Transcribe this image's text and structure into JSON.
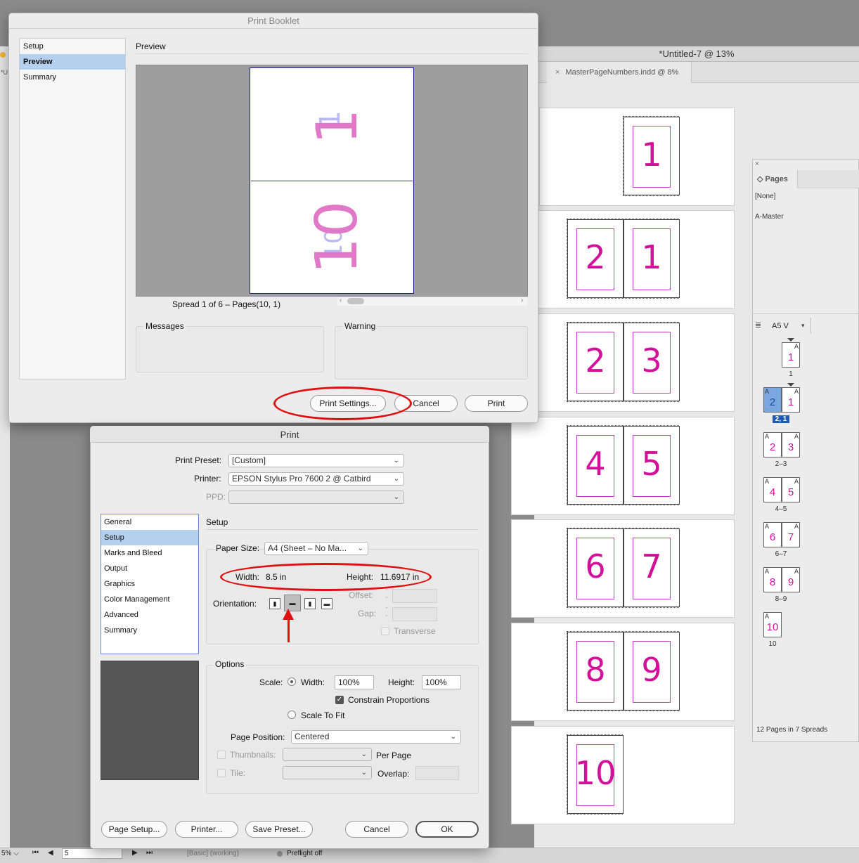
{
  "indesign": {
    "window_title": "*Untitled-7 @ 13%",
    "left_tab_fragment": "*U",
    "tabs": [
      {
        "label": "MasterPageNumbers.indd @ 8%",
        "close": "×"
      }
    ],
    "spreads": [
      {
        "pages": [
          "1"
        ]
      },
      {
        "pages": [
          "2",
          "1"
        ]
      },
      {
        "pages": [
          "2",
          "3"
        ]
      },
      {
        "pages": [
          "4",
          "5"
        ]
      },
      {
        "pages": [
          "6",
          "7"
        ]
      },
      {
        "pages": [
          "8",
          "9"
        ]
      },
      {
        "pages": [
          "10"
        ]
      }
    ],
    "pages_panel": {
      "close": "×",
      "title": "◇ Pages",
      "none_label": "[None]",
      "master_label": "A-Master",
      "menu_icon": "≣",
      "page_size": "A5 V",
      "size_caret": "▾",
      "footer": "12 Pages in 7 Spreads",
      "thumbs": [
        {
          "label": "1",
          "pages": [
            {
              "num": "1",
              "a": "A"
            }
          ]
        },
        {
          "label": "2, 1",
          "pages": [
            {
              "num": "2",
              "a": "A"
            },
            {
              "num": "1",
              "a": "A"
            }
          ],
          "selected": true
        },
        {
          "label": "2–3",
          "pages": [
            {
              "num": "2",
              "a": "A"
            },
            {
              "num": "3",
              "a": "A"
            }
          ]
        },
        {
          "label": "4–5",
          "pages": [
            {
              "num": "4",
              "a": "A"
            },
            {
              "num": "5",
              "a": "A"
            }
          ]
        },
        {
          "label": "6–7",
          "pages": [
            {
              "num": "6",
              "a": "A"
            },
            {
              "num": "7",
              "a": "A"
            }
          ]
        },
        {
          "label": "8–9",
          "pages": [
            {
              "num": "8",
              "a": "A"
            },
            {
              "num": "9",
              "a": "A"
            }
          ]
        },
        {
          "label": "10",
          "pages": [
            {
              "num": "10",
              "a": "A"
            }
          ]
        }
      ]
    },
    "statusbar": {
      "zoom": "5%  ⌵",
      "first": "⏮",
      "prev": "◀",
      "page": "5",
      "next": "▶",
      "last": "⏭",
      "profile": "[Basic] (working)",
      "preflight": "Preflight off"
    }
  },
  "booklet": {
    "title": "Print Booklet",
    "sidebar": [
      "Setup",
      "Preview",
      "Summary"
    ],
    "selected_index": 1,
    "heading": "Preview",
    "preview": {
      "top_page": "1",
      "bottom_page": "10"
    },
    "spread_text": "Spread 1 of 6 – Pages(10, 1)",
    "scroll_left": "‹",
    "scroll_right": "›",
    "messages_label": "Messages",
    "warning_label": "Warning",
    "buttons": {
      "print_settings": "Print Settings...",
      "cancel": "Cancel",
      "print": "Print"
    }
  },
  "print": {
    "title": "Print",
    "preset_label": "Print Preset:",
    "preset_value": "[Custom]",
    "printer_label": "Printer:",
    "printer_value": "EPSON Stylus Pro 7600 2 @ Catbird",
    "ppd_label": "PPD:",
    "categories": [
      "General",
      "Setup",
      "Marks and Bleed",
      "Output",
      "Graphics",
      "Color Management",
      "Advanced",
      "Summary"
    ],
    "selected_category": 1,
    "setup_heading": "Setup",
    "paper_size_label": "Paper Size:",
    "paper_size_value": "A4 (Sheet – No Ma...",
    "width_label": "Width:",
    "width_value": "8.5 in",
    "height_label": "Height:",
    "height_value": "11.6917 in",
    "orientation_label": "Orientation:",
    "offset_label": "Offset:",
    "gap_label": "Gap:",
    "transverse_label": "Transverse",
    "options_heading": "Options",
    "scale_label": "Scale:",
    "scale_width_label": "Width:",
    "scale_width_value": "100%",
    "scale_height_label": "Height:",
    "scale_height_value": "100%",
    "constrain_label": "Constrain Proportions",
    "scale_to_fit_label": "Scale To Fit",
    "page_position_label": "Page Position:",
    "page_position_value": "Centered",
    "thumbnails_label": "Thumbnails:",
    "per_page_label": "Per Page",
    "tile_label": "Tile:",
    "overlap_label": "Overlap:",
    "buttons": {
      "page_setup": "Page Setup...",
      "printer": "Printer...",
      "save_preset": "Save Preset...",
      "cancel": "Cancel",
      "ok": "OK"
    }
  },
  "colors": {
    "page_number": "#d4109a",
    "annotation": "#e01010",
    "selection": "#b5cfee"
  }
}
